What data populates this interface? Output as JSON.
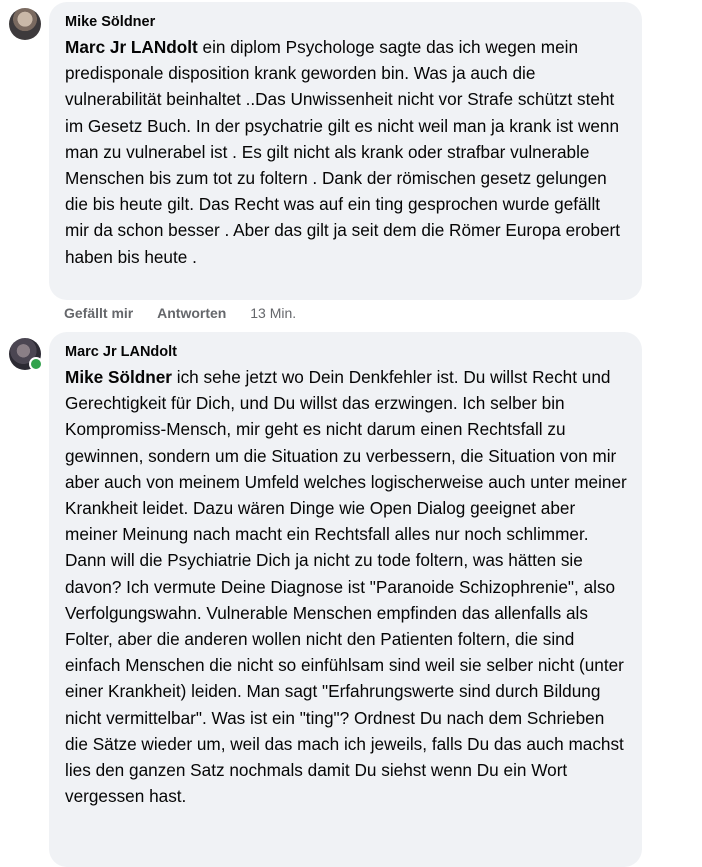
{
  "comments": [
    {
      "author": "Mike Söldner",
      "mention": "Marc Jr LANdolt",
      "text": " ein diplom Psychologe sagte das ich wegen mein predisponale disposition krank geworden bin. Was ja auch die vulnerabilität beinhaltet ..Das Unwissenheit nicht vor Strafe schützt steht im Gesetz Buch. In der psychatrie gilt es nicht weil man ja krank ist wenn man zu vulnerabel ist . Es gilt nicht als krank oder strafbar vulnerable Menschen bis zum tot zu foltern . Dank der römischen gesetz gelungen die bis heute gilt. Das Recht was auf ein ting gesprochen wurde gefällt mir da schon besser . Aber das gilt ja seit dem die Römer Europa erobert haben bis heute .",
      "like_label": "Gefällt mir",
      "reply_label": "Antworten",
      "time": "13 Min."
    },
    {
      "author": "Marc Jr LANdolt",
      "mention": "Mike Söldner",
      "text": " ich sehe jetzt wo Dein Denkfehler ist. Du willst Recht und Gerechtigkeit für Dich, und Du willst das erzwingen. Ich selber bin Kompromiss-Mensch, mir geht es nicht darum einen Rechtsfall zu gewinnen, sondern um die Situation zu verbessern, die Situation von mir aber auch von meinem Umfeld welches logischerweise auch unter meiner Krankheit leidet. Dazu wären Dinge wie Open Dialog geeignet aber meiner Meinung nach macht ein Rechtsfall alles nur noch schlimmer. Dann will die Psychiatrie Dich ja nicht zu tode foltern, was hätten sie davon? Ich vermute Deine Diagnose ist \"Paranoide Schizophrenie\", also Verfolgungswahn. Vulnerable Menschen empfinden das allenfalls als Folter, aber die anderen wollen nicht den Patienten foltern, die sind einfach Menschen die nicht so einfühlsam sind weil sie selber nicht (unter einer Krankheit) leiden. Man sagt \"Erfahrungswerte sind durch Bildung nicht vermittelbar\". Was ist ein \"ting\"? Ordnest Du nach dem Schrieben die Sätze wieder um, weil das mach ich jeweils, falls Du das auch machst lies den ganzen Satz nochmals damit Du siehst wenn Du ein Wort vergessen hast."
    }
  ]
}
